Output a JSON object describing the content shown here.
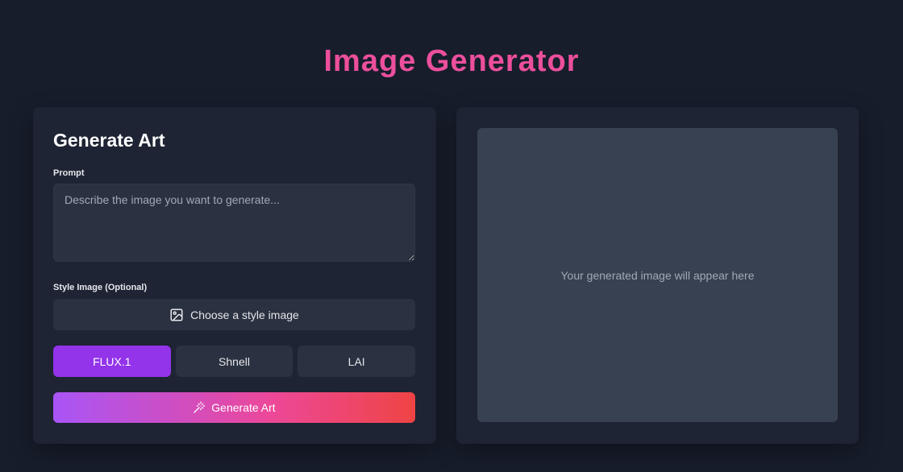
{
  "app": {
    "title": "Image Generator"
  },
  "form": {
    "title": "Generate Art",
    "prompt_label": "Prompt",
    "prompt_placeholder": "Describe the image you want to generate...",
    "prompt_value": "",
    "style_label": "Style Image (Optional)",
    "style_button_label": "Choose a style image",
    "models": [
      {
        "label": "FLUX.1",
        "selected": true
      },
      {
        "label": "Shnell",
        "selected": false
      },
      {
        "label": "LAI",
        "selected": false
      }
    ],
    "generate_label": "Generate Art"
  },
  "preview": {
    "placeholder": "Your generated image will appear here"
  },
  "colors": {
    "background": "#171d2b",
    "card": "#1e2433",
    "title_accent": "#ec4f9c",
    "selected_model": "#9333ea",
    "gradient_start": "#a855f7",
    "gradient_mid": "#ec4899",
    "gradient_end": "#ef4444"
  },
  "icons": {
    "style_button": "image-icon",
    "generate_button": "magic-wand-icon"
  }
}
